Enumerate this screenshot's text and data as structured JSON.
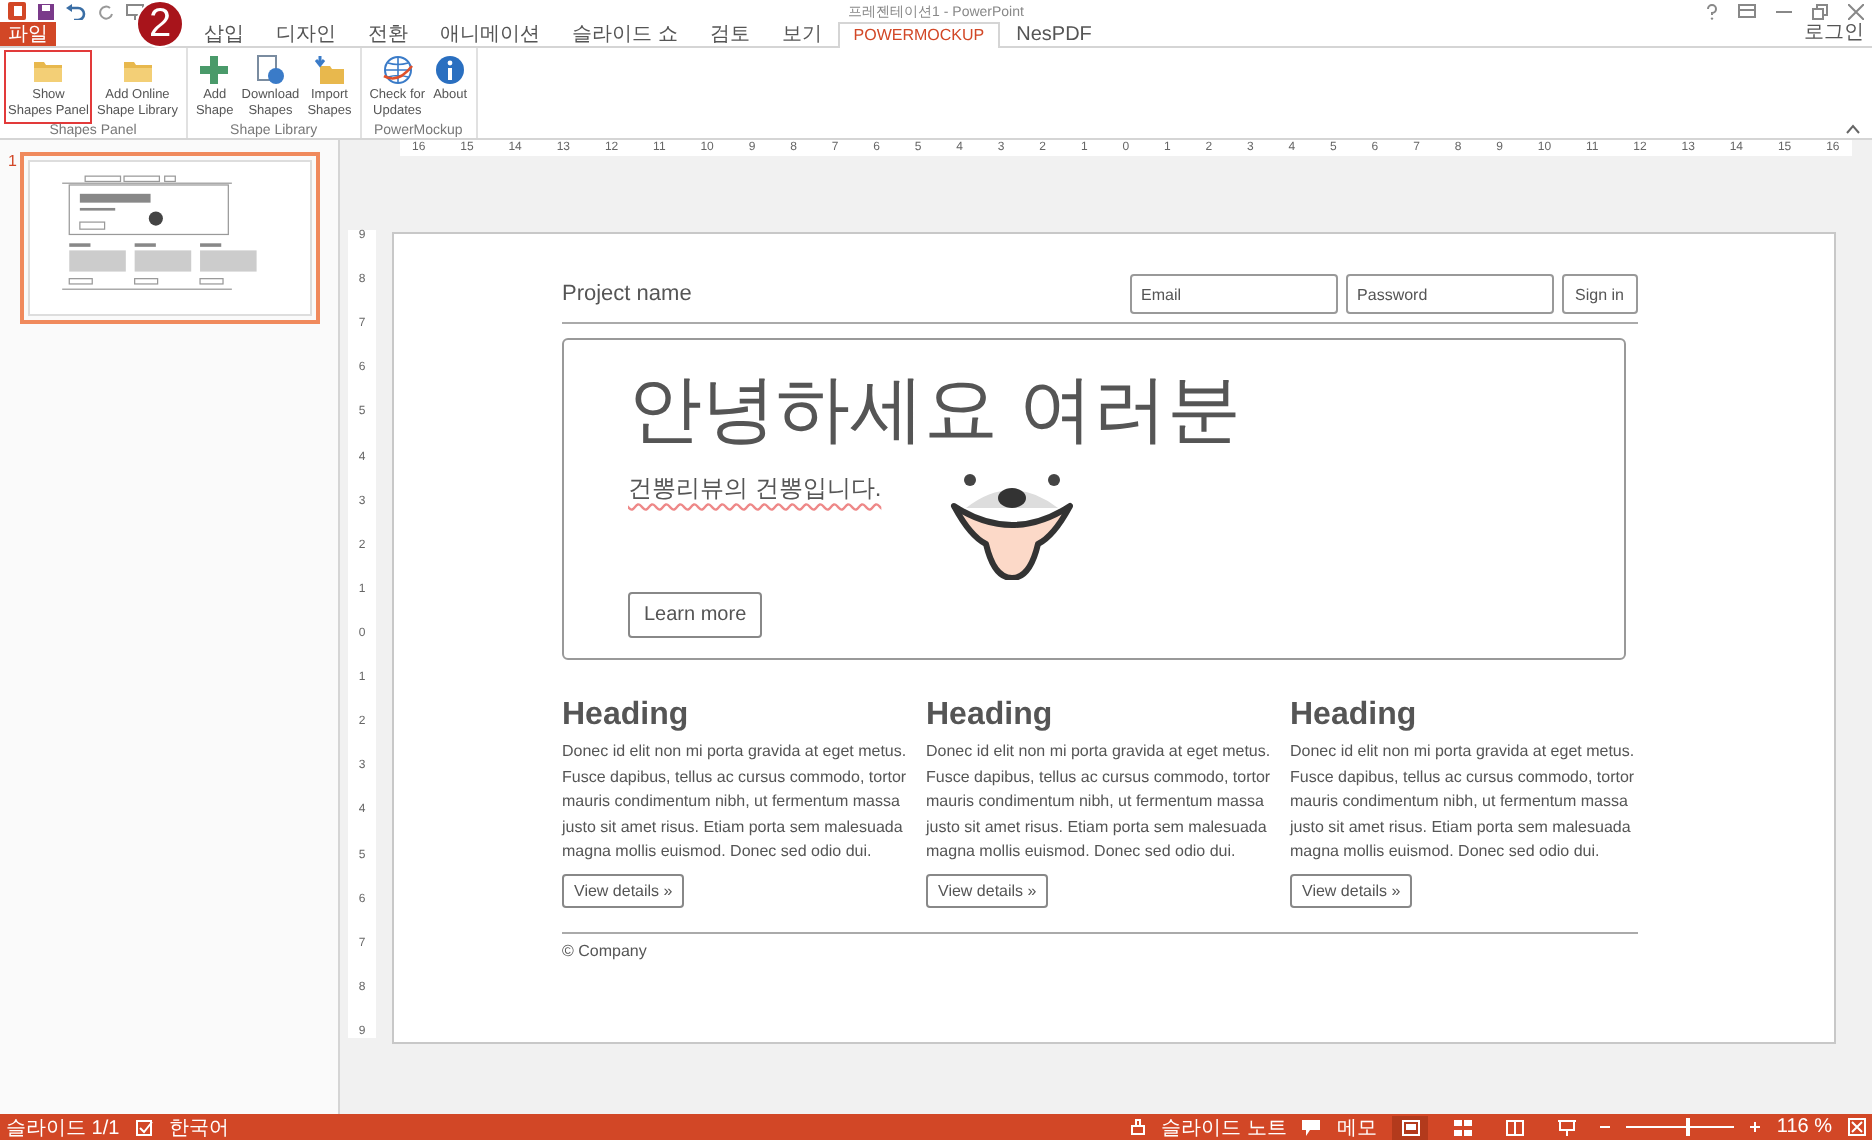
{
  "window": {
    "title": "프레젠테이션1 - PowerPoint",
    "account": "로그인"
  },
  "tabs": [
    {
      "label": "파일",
      "kind": "file",
      "selected": false
    },
    {
      "label": "삽입",
      "kind": "tab",
      "selected": false
    },
    {
      "label": "디자인",
      "kind": "tab",
      "selected": false
    },
    {
      "label": "전환",
      "kind": "tab",
      "selected": false
    },
    {
      "label": "애니메이션",
      "kind": "tab",
      "selected": false
    },
    {
      "label": "슬라이드 쇼",
      "kind": "tab",
      "selected": false
    },
    {
      "label": "검토",
      "kind": "tab",
      "selected": false
    },
    {
      "label": "보기",
      "kind": "tab",
      "selected": false
    },
    {
      "label": "POWERMOCKUP",
      "kind": "tab",
      "selected": true
    },
    {
      "label": "NesPDF",
      "kind": "tab",
      "selected": false
    }
  ],
  "callout": {
    "number": "2"
  },
  "ribbon": {
    "groups": [
      {
        "label": "Shapes Panel",
        "buttons": [
          {
            "lines": [
              "Show",
              "Shapes Panel"
            ],
            "kind": "folder",
            "highlighted": true
          },
          {
            "lines": [
              "Add Online",
              "Shape Library"
            ],
            "kind": "folder",
            "highlighted": false
          }
        ]
      },
      {
        "label": "Shape Library",
        "buttons": [
          {
            "lines": [
              "Add",
              "Shape"
            ],
            "kind": "plus",
            "highlighted": false
          },
          {
            "lines": [
              "Download",
              "Shapes"
            ],
            "kind": "download",
            "highlighted": false
          },
          {
            "lines": [
              "Import",
              "Shapes"
            ],
            "kind": "import",
            "highlighted": false
          }
        ]
      },
      {
        "label": "PowerMockup",
        "buttons": [
          {
            "lines": [
              "Check for",
              "Updates"
            ],
            "kind": "globe",
            "highlighted": false
          },
          {
            "lines": [
              "About"
            ],
            "kind": "info",
            "highlighted": false
          }
        ]
      }
    ]
  },
  "slides_pane": {
    "thumbnails": [
      {
        "number": "1",
        "selected": true
      }
    ]
  },
  "rulers": {
    "horizontal": [
      "16",
      "15",
      "14",
      "13",
      "12",
      "11",
      "10",
      "9",
      "8",
      "7",
      "6",
      "5",
      "4",
      "3",
      "2",
      "1",
      "0",
      "1",
      "2",
      "3",
      "4",
      "5",
      "6",
      "7",
      "8",
      "9",
      "10",
      "11",
      "12",
      "13",
      "14",
      "15",
      "16"
    ],
    "vertical": [
      "9",
      "8",
      "7",
      "6",
      "5",
      "4",
      "3",
      "2",
      "1",
      "0",
      "1",
      "2",
      "3",
      "4",
      "5",
      "6",
      "7",
      "8",
      "9"
    ]
  },
  "slide": {
    "navbar": {
      "brand": "Project name",
      "fields": [
        {
          "placeholder": "Email"
        },
        {
          "placeholder": "Password"
        }
      ],
      "button": "Sign in"
    },
    "hero": {
      "title": "안녕하세요 여러분",
      "subtitle": "건뽕리뷰의 건뽕입니다.",
      "button": "Learn more"
    },
    "columns": [
      {
        "heading": "Heading",
        "text": "Donec id elit non mi porta gravida at eget metus. Fusce dapibus, tellus ac cursus commodo, tortor mauris condimentum nibh, ut fermentum massa justo sit amet risus. Etiam porta sem malesuada magna mollis euismod. Donec sed odio dui.",
        "button": "View details »"
      },
      {
        "heading": "Heading",
        "text": "Donec id elit non mi porta gravida at eget metus. Fusce dapibus, tellus ac cursus commodo, tortor mauris condimentum nibh, ut fermentum massa justo sit amet risus. Etiam porta sem malesuada magna mollis euismod. Donec sed odio dui.",
        "button": "View details »"
      },
      {
        "heading": "Heading",
        "text": "Donec id elit non mi porta gravida at eget metus. Fusce dapibus, tellus ac cursus commodo, tortor mauris condimentum nibh, ut fermentum massa justo sit amet risus. Etiam porta sem malesuada magna mollis euismod. Donec sed odio dui.",
        "button": "View details »"
      }
    ],
    "footer": "© Company"
  },
  "status_bar": {
    "slide_counter": "슬라이드 1/1",
    "language": "한국어",
    "notes": "슬라이드 노트",
    "comments": "메모",
    "views": [
      {
        "kind": "normal",
        "selected": true
      },
      {
        "kind": "sorter",
        "selected": false
      },
      {
        "kind": "reading",
        "selected": false
      },
      {
        "kind": "slideshow",
        "selected": false
      }
    ],
    "zoom": {
      "level": 0.55,
      "reading": "116 %"
    }
  }
}
